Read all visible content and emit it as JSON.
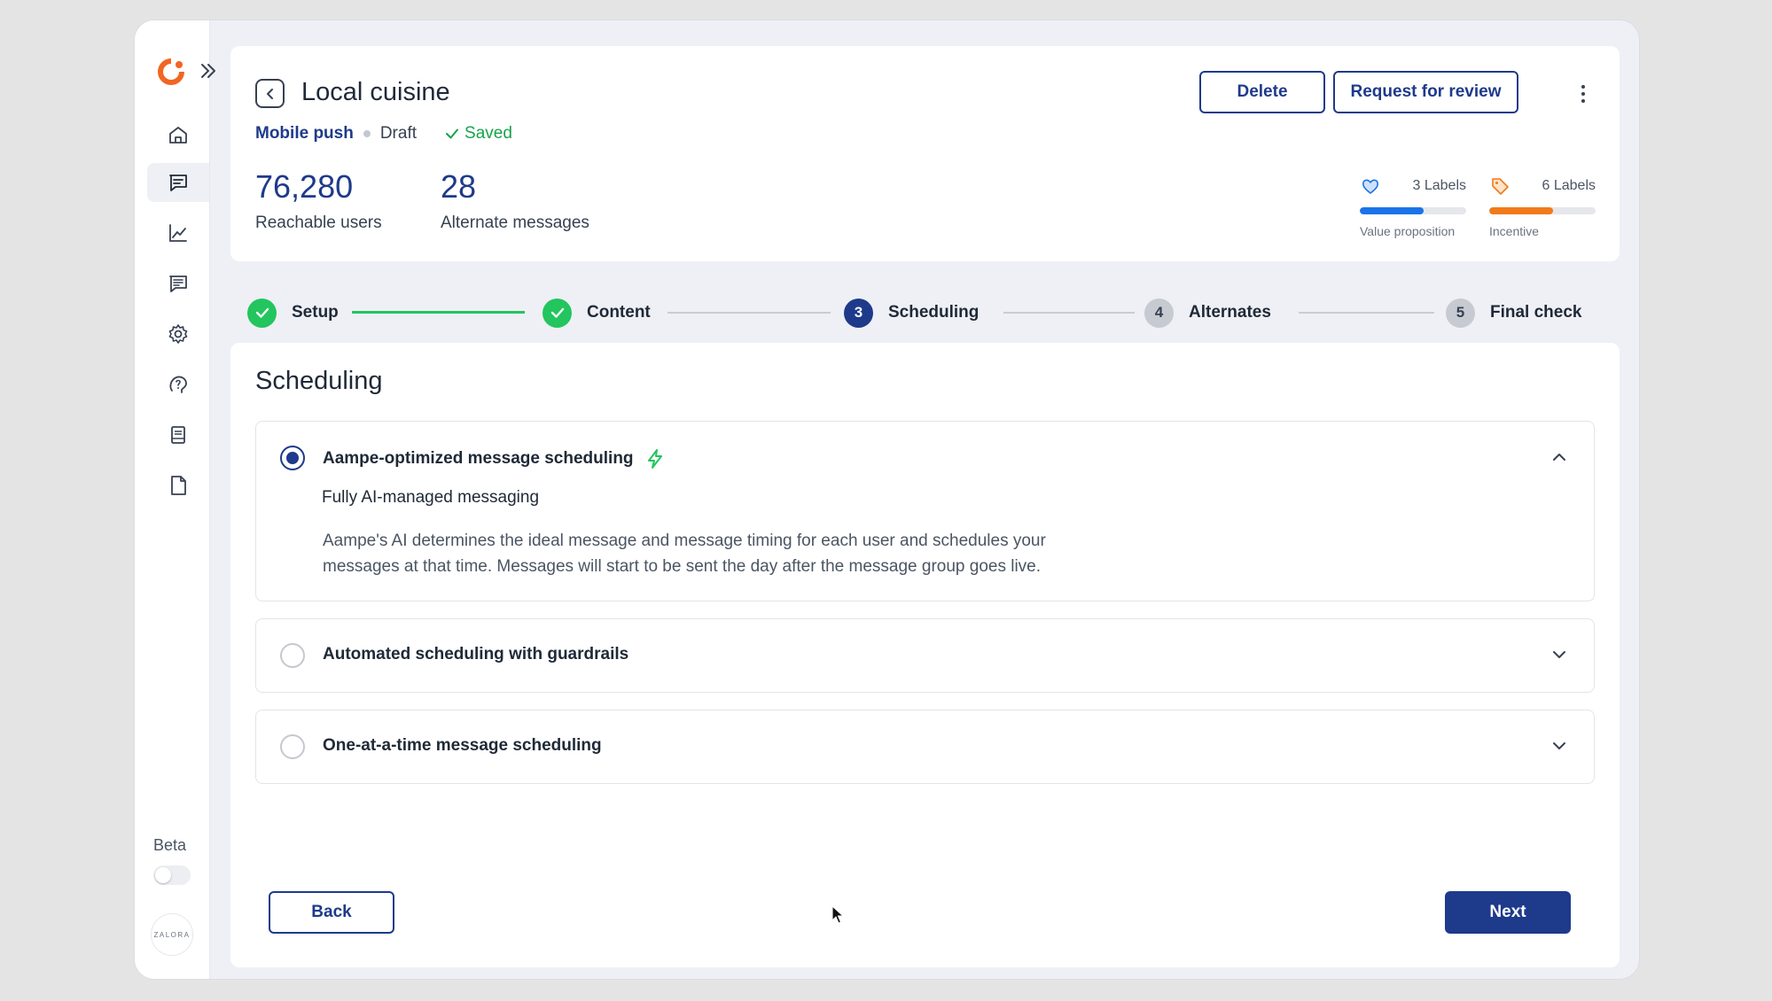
{
  "header": {
    "title": "Local cuisine",
    "channel": "Mobile push",
    "status": "Draft",
    "saved_label": "Saved",
    "delete_label": "Delete",
    "review_label": "Request for review"
  },
  "stats": [
    {
      "value": "76,280",
      "label": "Reachable users"
    },
    {
      "value": "28",
      "label": "Alternate messages"
    }
  ],
  "label_metrics": [
    {
      "icon": "heart-icon",
      "count": "3 Labels",
      "name": "Value proposition",
      "fill_fraction": 0.6,
      "color": "#1a73e8"
    },
    {
      "icon": "tag-icon",
      "count": "6 Labels",
      "name": "Incentive",
      "fill_fraction": 0.6,
      "color": "#f07a1a"
    }
  ],
  "steps": [
    {
      "label": "Setup",
      "state": "done"
    },
    {
      "label": "Content",
      "state": "done"
    },
    {
      "number": "3",
      "label": "Scheduling",
      "state": "current"
    },
    {
      "number": "4",
      "label": "Alternates",
      "state": "pending"
    },
    {
      "number": "5",
      "label": "Final check",
      "state": "pending"
    }
  ],
  "main": {
    "section_title": "Scheduling",
    "options": [
      {
        "title": "Aampe-optimized message scheduling",
        "selected": true,
        "expanded": true,
        "subtitle": "Fully AI-managed messaging",
        "description": "Aampe's AI determines the ideal message and message timing for each user and schedules your messages at that time. Messages will start to be sent the day after the message group goes live."
      },
      {
        "title": "Automated scheduling with guardrails",
        "selected": false,
        "expanded": false
      },
      {
        "title": "One-at-a-time message scheduling",
        "selected": false,
        "expanded": false
      }
    ],
    "back_label": "Back",
    "next_label": "Next"
  },
  "sidebar": {
    "items": [
      {
        "icon": "home-icon"
      },
      {
        "icon": "messages-icon",
        "active": true
      },
      {
        "icon": "analytics-icon"
      },
      {
        "icon": "message-board-icon"
      },
      {
        "icon": "settings-icon"
      },
      {
        "icon": "help-icon"
      },
      {
        "icon": "library-icon"
      },
      {
        "icon": "document-icon"
      }
    ],
    "beta_label": "Beta",
    "avatar_text": "ZALORA"
  },
  "colors": {
    "primary": "#1e3a8a",
    "success": "#22c55e",
    "brand": "#f26522"
  }
}
